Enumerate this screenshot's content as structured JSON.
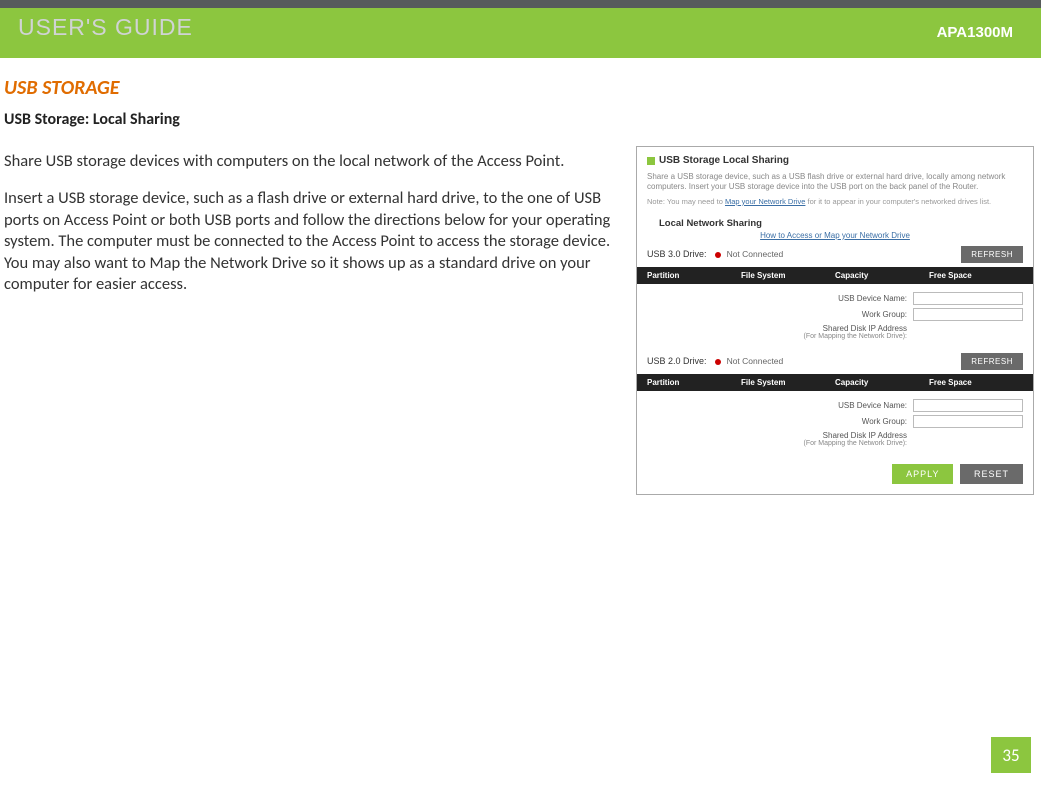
{
  "header": {
    "title": "USER'S GUIDE",
    "model": "APA1300M"
  },
  "section": {
    "title": "USB STORAGE",
    "subtitle": "USB Storage: Local Sharing",
    "para1": "Share USB storage devices with computers on the local network of the Access Point.",
    "para2": "Insert a USB storage device, such as a flash drive or external hard drive, to the one of USB ports on Access Point or both USB ports and follow the directions below for your operating system.  The computer must be connected to the Access Point to access the storage device.  You may also want to Map the Network Drive so it shows up as a standard drive on your computer for easier access."
  },
  "panel": {
    "title": "USB Storage Local Sharing",
    "desc": "Share a USB storage device, such as a USB flash drive or external hard drive, locally among network computers. Insert your USB storage device into the USB port on the back panel of the Router.",
    "note_prefix": "Note: You may need to ",
    "note_link": "Map your Network Drive",
    "note_suffix": " for it to appear in your computer's networked drives list.",
    "section_head": "Local Network Sharing",
    "access_link": "How to Access or Map your Network Drive",
    "usb30_label": "USB 3.0 Drive:",
    "usb20_label": "USB 2.0 Drive:",
    "not_connected": "Not Connected",
    "refresh": "REFRESH",
    "cols": {
      "partition": "Partition",
      "fs": "File System",
      "capacity": "Capacity",
      "free": "Free Space"
    },
    "form": {
      "usb_name": "USB Device Name:",
      "workgroup": "Work Group:",
      "ip_label": "Shared Disk IP Address",
      "ip_sub": "(For Mapping the Network Drive):"
    },
    "apply": "APPLY",
    "reset": "RESET"
  },
  "page_number": "35"
}
